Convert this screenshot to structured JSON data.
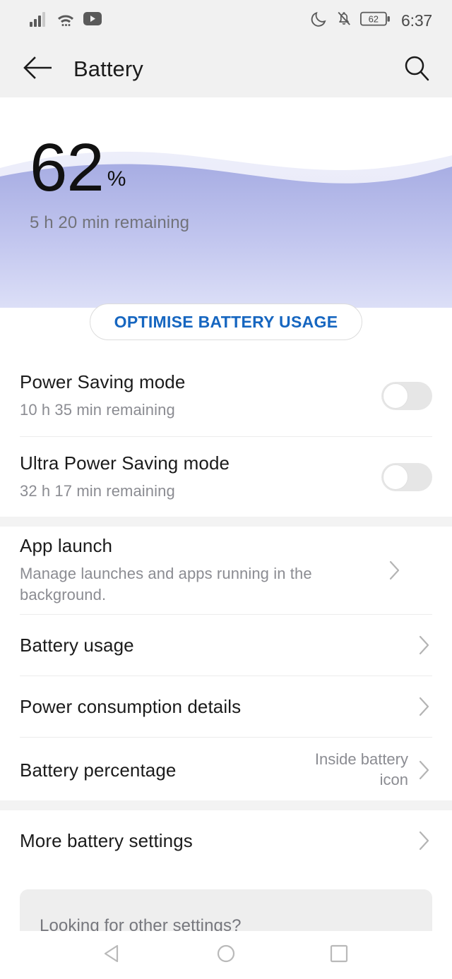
{
  "statusbar": {
    "icons_left": [
      "signal-bars-icon",
      "wifi-icon",
      "youtube-icon"
    ],
    "icons_right": [
      "do-not-disturb-moon-icon",
      "bell-muted-icon",
      "battery-icon"
    ],
    "battery_level": "62",
    "time": "6:37"
  },
  "header": {
    "back_icon": "back-arrow-icon",
    "title": "Battery",
    "search_icon": "search-icon"
  },
  "hero": {
    "percent": "62",
    "percent_sign": "%",
    "remaining": "5 h 20 min remaining",
    "wave_color_front_top": "#a7ade3",
    "wave_color_front_bottom": "#dcdff7",
    "wave_color_back": "#eceef9"
  },
  "optimise": {
    "label": "OPTIMISE BATTERY USAGE",
    "accent_color": "#1666c0"
  },
  "toggles": [
    {
      "title": "Power Saving mode",
      "subtitle": "10 h 35 min remaining",
      "state": "off"
    },
    {
      "title": "Ultra Power Saving mode",
      "subtitle": "32 h 17 min remaining",
      "state": "off"
    }
  ],
  "settings": [
    {
      "title": "App launch",
      "subtitle": "Manage launches and apps running in the background.",
      "value": "",
      "chevron": "chevron-right-icon"
    },
    {
      "title": "Battery usage",
      "subtitle": "",
      "value": "",
      "chevron": "chevron-right-icon"
    },
    {
      "title": "Power consumption details",
      "subtitle": "",
      "value": "",
      "chevron": "chevron-right-icon"
    },
    {
      "title": "Battery percentage",
      "subtitle": "",
      "value": "Inside battery icon",
      "chevron": "chevron-right-icon"
    }
  ],
  "more": {
    "title": "More battery settings",
    "chevron": "chevron-right-icon"
  },
  "other_settings": {
    "text": "Looking for other settings?"
  },
  "navbar": {
    "back": "nav-back-triangle-icon",
    "home": "nav-home-circle-icon",
    "recents": "nav-recents-square-icon"
  }
}
